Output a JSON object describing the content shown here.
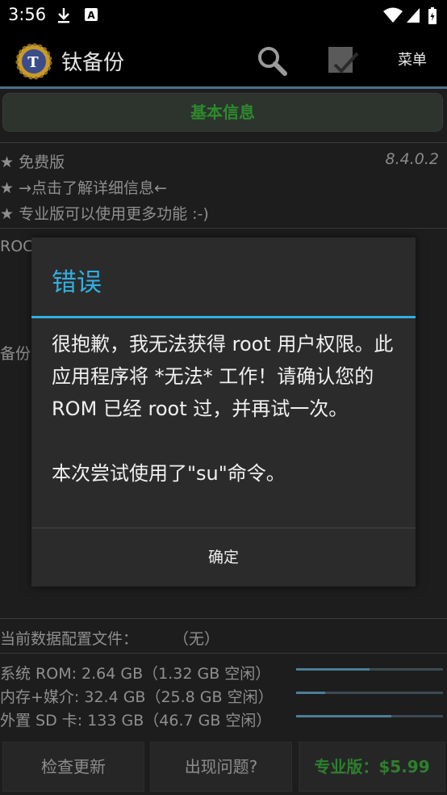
{
  "status_bar": {
    "time": "3:56",
    "icons": [
      "download-icon",
      "a-notification-icon",
      "wifi-icon",
      "signal-icon",
      "battery-icon"
    ]
  },
  "action_bar": {
    "app_title": "钛备份",
    "menu_label": "菜单",
    "icons": [
      "app-logo-icon",
      "search-icon",
      "batch-check-icon"
    ]
  },
  "main": {
    "basic_info_button": "基本信息",
    "info_lines": [
      "★ 免费版",
      "★  →点击了解详细信息←",
      "★ 专业版可以使用更多功能 :-)"
    ],
    "version": "8.4.0.2",
    "partial_text_1": "ROC",
    "partial_text_2": "备份",
    "profile_label": "当前数据配置文件：",
    "profile_value": "（无）",
    "storage": [
      {
        "text": "系统 ROM:  2.64 GB（1.32 GB 空闲）",
        "used_fraction": 0.5
      },
      {
        "text": "内存+媒介:  32.4 GB（25.8 GB 空闲）",
        "used_fraction": 0.2
      },
      {
        "text": "外置 SD 卡:  133 GB（46.7 GB 空闲）",
        "used_fraction": 0.65
      }
    ],
    "bottom_buttons": {
      "check_update": "检查更新",
      "problem": "出现问题?",
      "pro": "专业版：$5.99"
    }
  },
  "dialog": {
    "title": "错误",
    "message": "很抱歉，我无法获得 root 用户权限。此应用程序将 *无法* 工作！请确认您的 ROM 已经 root 过，并再试一次。\n\n本次尝试使用了\"su\"命令。",
    "ok_label": "确定"
  },
  "colors": {
    "accent": "#33aee0",
    "pro_green": "#2e7f2e",
    "dialog_bg": "#2b2b2b"
  }
}
